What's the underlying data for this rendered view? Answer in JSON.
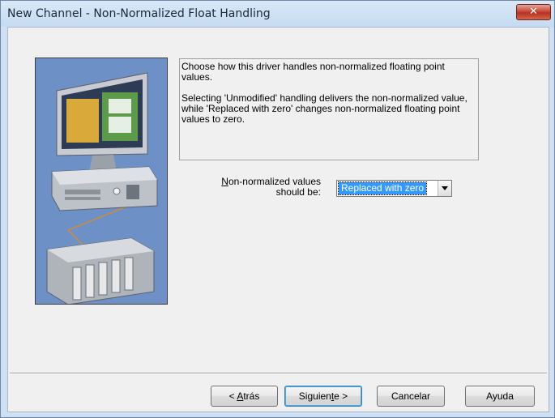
{
  "window": {
    "title": "New Channel - Non-Normalized Float Handling",
    "close_glyph": "✕"
  },
  "description": {
    "para1": "Choose how this driver handles non-normalized floating point values.",
    "para2": "Selecting 'Unmodified' handling delivers the non-normalized value, while 'Replaced with zero' changes non-normalized floating point values to zero."
  },
  "option": {
    "label_line1_mnemonic": "N",
    "label_line1_rest": "on-normalized values",
    "label_line2": "should be:",
    "selected_value": "Replaced with zero"
  },
  "buttons": {
    "back_prefix": "< ",
    "back_mnemonic": "A",
    "back_rest": "trás",
    "next_prefix": "Siguien",
    "next_mnemonic": "t",
    "next_rest": "e >",
    "cancel": "Cancelar",
    "help": "Ayuda"
  },
  "icons": {
    "close": "close-icon",
    "dropdown": "chevron-down-icon",
    "illustration": "computer-plc-illustration"
  },
  "colors": {
    "selection": "#3399ff",
    "illustration_bg": "#6d91c6",
    "close_button": "#c8493a"
  }
}
